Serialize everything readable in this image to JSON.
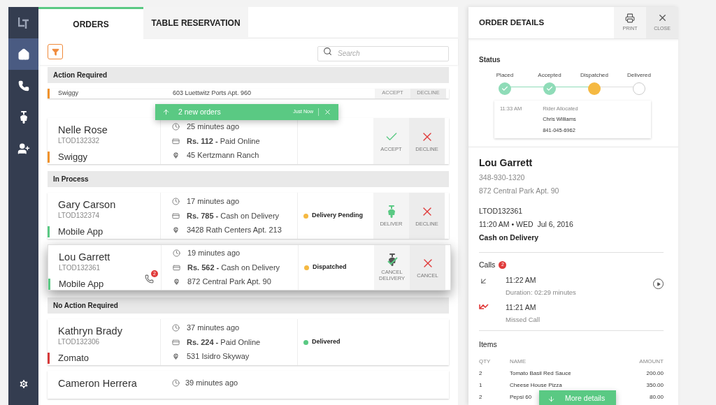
{
  "sidebar": {
    "nav_items": [
      {
        "kind": "home",
        "selected": true
      },
      {
        "kind": "phone",
        "selected": false
      },
      {
        "kind": "scooter",
        "selected": false
      },
      {
        "kind": "add-user",
        "selected": false
      }
    ]
  },
  "tabs": [
    {
      "label": "ORDERS",
      "selected": true
    },
    {
      "label": "TABLE RESERVATION",
      "selected": false
    }
  ],
  "search": {
    "placeholder": "Search"
  },
  "toast": {
    "text": "2 new orders",
    "time": "Just Now"
  },
  "sections": [
    {
      "title": "Action Required",
      "orders": [
        {
          "kind": "partial",
          "source": "Swiggy",
          "color": "#f0922b",
          "address": "603 Luettwitz Ports Apt. 960",
          "actions": [
            {
              "kind": "accept",
              "label": "ACCEPT"
            },
            {
              "kind": "decline",
              "label": "DECLINE"
            }
          ]
        },
        {
          "kind": "full",
          "selected": false,
          "name": "Nelle Rose",
          "id": "LTOD132332",
          "source": "Swiggy",
          "color": "#f0922b",
          "time": "25 minutes ago",
          "amount": "Rs. 112 -",
          "payment": "Paid Online",
          "address": "45 Kertzmann Ranch",
          "actions": [
            {
              "kind": "accept",
              "label": "ACCEPT"
            },
            {
              "kind": "decline",
              "label": "DECLINE"
            }
          ]
        }
      ]
    },
    {
      "title": "In Process",
      "orders": [
        {
          "kind": "full",
          "selected": false,
          "name": "Gary Carson",
          "id": "LTOD132374",
          "source": "Mobile App",
          "color": "#5ac983",
          "time": "17 minutes ago",
          "amount": "Rs. 785 -",
          "payment": "Cash on Delivery",
          "address": "3428 Rath Centers Apt. 213",
          "status": {
            "label": "Delivery Pending",
            "color": "#f5b942"
          },
          "actions": [
            {
              "kind": "deliver",
              "label": "DELIVER"
            },
            {
              "kind": "decline",
              "label": "DECLINE"
            }
          ]
        },
        {
          "kind": "full",
          "selected": true,
          "name": "Lou Garrett",
          "id": "LTOD132361",
          "source": "Mobile App",
          "color": "#5ac983",
          "calls": "2",
          "time": "19 minutes ago",
          "amount": "Rs. 562 -",
          "payment": "Cash on Delivery",
          "address": "872 Central Park Apt. 90",
          "status": {
            "label": "Dispatched",
            "color": "#f5b942"
          },
          "actions": [
            {
              "kind": "cancel-delivery",
              "label": "CANCEL DELIVERY"
            },
            {
              "kind": "decline",
              "label": "CANCEL"
            }
          ]
        }
      ]
    },
    {
      "title": "No Action Required",
      "orders": [
        {
          "kind": "full",
          "selected": false,
          "name": "Kathryn Brady",
          "id": "LTOD132306",
          "source": "Zomato",
          "color": "#d63a3a",
          "time": "37 minutes ago",
          "amount": "Rs. 224 -",
          "payment": "Paid Online",
          "address": "531 Isidro Skyway",
          "status": {
            "label": "Delivered",
            "color": "#5ac983"
          }
        },
        {
          "kind": "cut",
          "name": "Cameron Herrera",
          "time": "39 minutes ago"
        }
      ]
    }
  ],
  "details": {
    "title": "ORDER DETAILS",
    "buttons": [
      {
        "kind": "print",
        "label": "PRINT"
      },
      {
        "kind": "close",
        "label": "CLOSE"
      }
    ],
    "status_heading": "Status",
    "steps": [
      {
        "label": "Placed",
        "completed": true,
        "selected": false
      },
      {
        "label": "Accepted",
        "completed": true,
        "selected": false
      },
      {
        "label": "Dispatched",
        "completed": false,
        "selected": true
      },
      {
        "label": "Delivered",
        "completed": false,
        "selected": false
      }
    ],
    "event": {
      "time": "11:33 AM",
      "title": "Rider Allocated",
      "name": "Chris Williams",
      "phone": "841-045-6962"
    },
    "customer": {
      "name": "Lou Garrett",
      "phone": "348-930-1320",
      "address": "872 Central Park Apt. 90",
      "order_id": "LTOD132361",
      "datetime": "11:20 AM • WED  Jul 6, 2016",
      "payment": "Cash on Delivery"
    },
    "calls_heading": "Calls",
    "calls_count": "2",
    "calls": [
      {
        "kind": "incoming",
        "time": "11:22 AM",
        "detail": "Duration: 02:29 minutes",
        "playable": true
      },
      {
        "kind": "missed",
        "time": "11:21 AM",
        "detail": "Missed Call",
        "playable": false
      }
    ],
    "items_heading": "Items",
    "columns": [
      "QTY",
      "NAME",
      "AMOUNT"
    ],
    "items": [
      {
        "qty": "2",
        "name": "Tomato Basil Red Sauce",
        "amount": "200.00"
      },
      {
        "qty": "1",
        "name": "Cheese House Pizza",
        "amount": "350.00"
      },
      {
        "qty": "2",
        "name": "Pepsi 60",
        "amount": "80.00"
      }
    ],
    "more_button": "More details"
  }
}
